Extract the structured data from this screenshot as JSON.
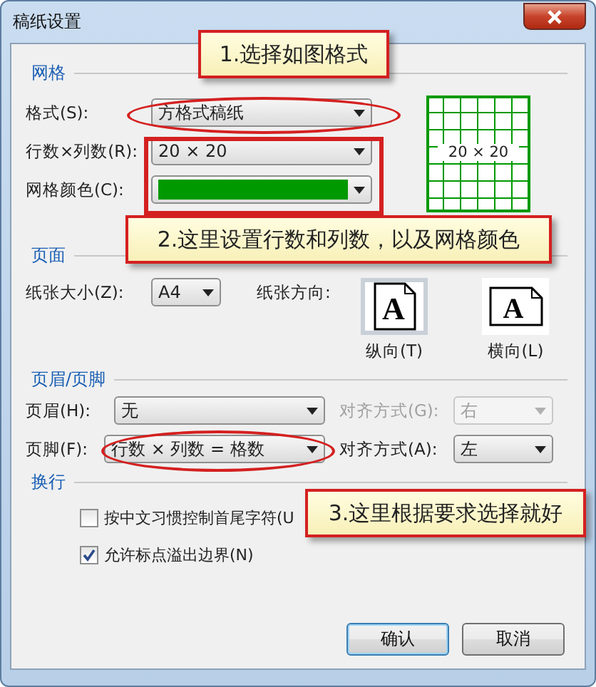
{
  "window": {
    "title": "稿纸设置"
  },
  "grid": {
    "title": "网格",
    "format": {
      "label": "格式(S):",
      "value": "方格式稿纸"
    },
    "rows_cols": {
      "label": "行数×列数(R):",
      "value": "20 × 20"
    },
    "grid_color": {
      "label": "网格颜色(C):",
      "color": "#009900"
    },
    "preview": {
      "text": "20 × 20"
    }
  },
  "page": {
    "title": "页面",
    "paper_size": {
      "label": "纸张大小(Z):",
      "value": "A4"
    },
    "orientation_label": "纸张方向:",
    "orientations": [
      {
        "label": "纵向(T)",
        "glyph": "A",
        "selected": true
      },
      {
        "label": "横向(L)",
        "glyph": "A",
        "selected": false
      }
    ]
  },
  "header_footer": {
    "title": "页眉/页脚",
    "rows": [
      {
        "label": "页眉(H):",
        "value": "无",
        "align_label": "对齐方式(G):",
        "align_value": "右",
        "align_disabled": true
      },
      {
        "label": "页脚(F):",
        "value": "行数 × 列数 = 格数",
        "align_label": "对齐方式(A):",
        "align_value": "左",
        "align_disabled": false
      }
    ]
  },
  "wrap": {
    "title": "换行",
    "options": [
      {
        "label": "按中文习惯控制首尾字符(U",
        "checked": false
      },
      {
        "label": "允许标点溢出边界(N)",
        "checked": true
      }
    ]
  },
  "buttons": [
    {
      "label": "确认",
      "default": true
    },
    {
      "label": "取消",
      "default": false
    }
  ],
  "callouts": [
    "1.选择如图格式",
    "2.这里设置行数和列数，以及网格颜色",
    "3.这里根据要求选择就好"
  ]
}
